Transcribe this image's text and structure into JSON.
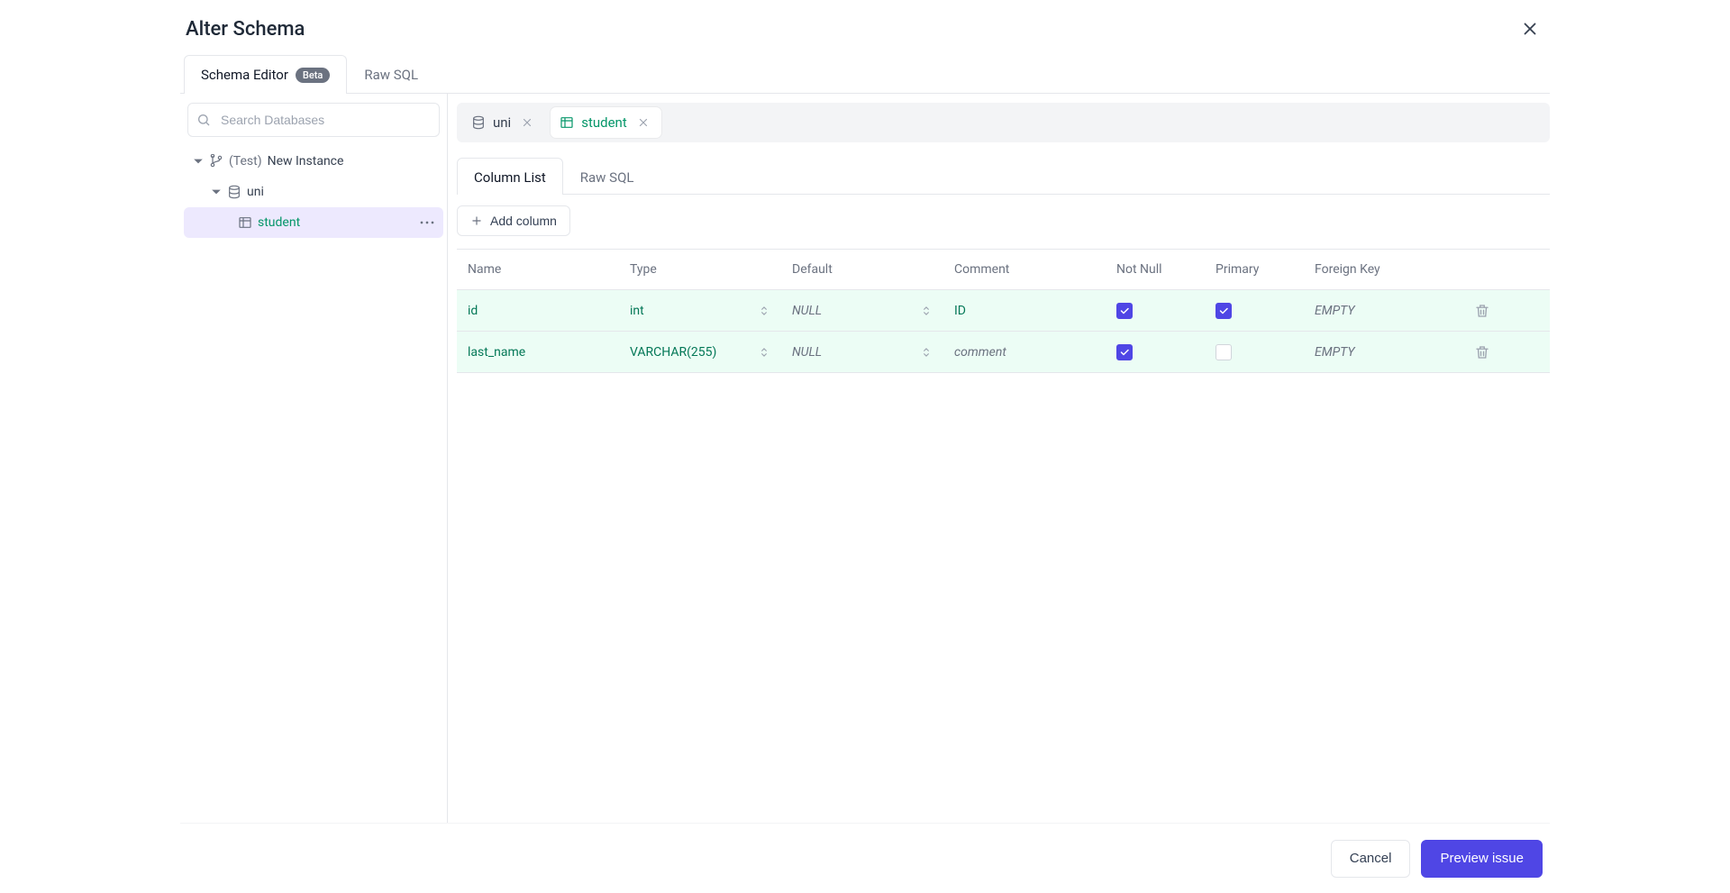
{
  "title": "Alter Schema",
  "top_tabs": {
    "schema_editor_label": "Schema Editor",
    "beta_badge": "Beta",
    "raw_sql_label": "Raw SQL"
  },
  "search": {
    "placeholder": "Search Databases"
  },
  "tree": {
    "instance_prefix": "(Test)",
    "instance_label": "New Instance",
    "database_label": "uni",
    "table_label": "student"
  },
  "breadcrumb": {
    "database": "uni",
    "table": "student"
  },
  "inner_tabs": {
    "column_list": "Column List",
    "raw_sql": "Raw SQL"
  },
  "add_column_label": "Add column",
  "column_headers": {
    "name": "Name",
    "type": "Type",
    "default": "Default",
    "comment": "Comment",
    "not_null": "Not Null",
    "primary": "Primary",
    "foreign_key": "Foreign Key"
  },
  "placeholders": {
    "null": "NULL",
    "empty": "EMPTY",
    "comment": "comment"
  },
  "columns": [
    {
      "name": "id",
      "type": "int",
      "default": "NULL",
      "default_is_placeholder": true,
      "comment": "ID",
      "comment_is_placeholder": false,
      "not_null": true,
      "primary": true,
      "foreign_key": "EMPTY"
    },
    {
      "name": "last_name",
      "type": "VARCHAR(255)",
      "default": "NULL",
      "default_is_placeholder": true,
      "comment": "comment",
      "comment_is_placeholder": true,
      "not_null": true,
      "primary": false,
      "foreign_key": "EMPTY"
    }
  ],
  "footer": {
    "cancel": "Cancel",
    "preview": "Preview issue"
  }
}
